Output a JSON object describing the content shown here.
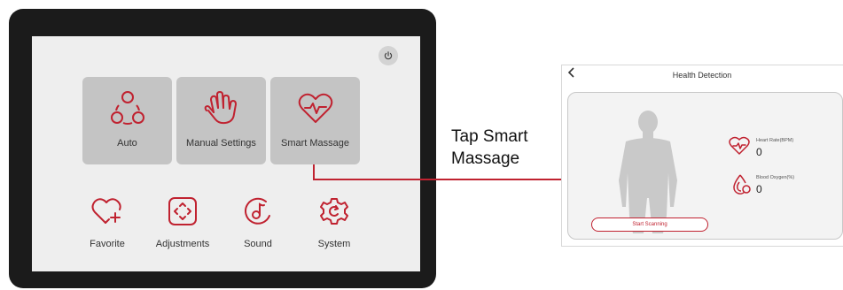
{
  "colors": {
    "accent": "#c02230",
    "tile_bg": "#c4c4c4",
    "screen_bg": "#eeeeee",
    "tablet_frame": "#1b1b1b"
  },
  "tablet": {
    "power_icon": "power-icon",
    "tiles": [
      {
        "label": "Auto",
        "icon": "auto-icon"
      },
      {
        "label": "Manual Settings",
        "icon": "hand-icon"
      },
      {
        "label": "Smart Massage",
        "icon": "heart-pulse-icon"
      }
    ],
    "features": [
      {
        "label": "Favorite",
        "icon": "heart-plus-icon"
      },
      {
        "label": "Adjustments",
        "icon": "adjust-icon"
      },
      {
        "label": "Sound",
        "icon": "music-icon"
      },
      {
        "label": "System",
        "icon": "gear-icon"
      }
    ]
  },
  "callout": {
    "line1": "Tap Smart",
    "line2": "Massage"
  },
  "health": {
    "back_icon": "chevron-left-icon",
    "title": "Health Detection",
    "heart_rate_label": "Heart Rate(BPM)",
    "heart_rate_value": "0",
    "oxygen_label": "Blood Oxygen(%)",
    "oxygen_value": "0",
    "scan_button": "Start Scanning"
  }
}
